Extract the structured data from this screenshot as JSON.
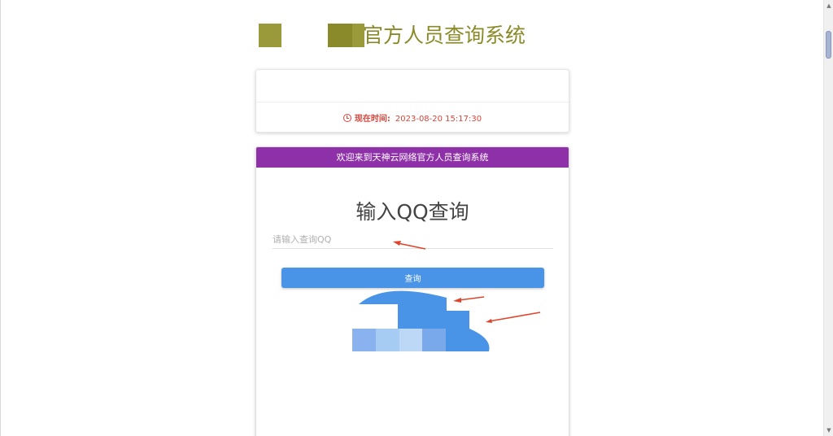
{
  "header": {
    "site_title": "官方人员查询系统"
  },
  "time_card": {
    "label": "现在时间:",
    "value": "2023-08-20 15:17:30"
  },
  "panel": {
    "header_text": "欢迎来到天神云网络官方人员查询系统",
    "heading": "输入QQ查询",
    "input_placeholder": "请输入查询QQ",
    "input_value": "",
    "button_label": "查询"
  },
  "colors": {
    "panel_header_bg": "#8e30a8",
    "button_bg": "#4a94e8",
    "time_text": "#d9453b",
    "title_text": "#8a8a28",
    "annotation_arrow": "#e0452c"
  },
  "icons": {
    "time": "clock-icon",
    "scroll_up": "chevron-up-icon",
    "scroll_down": "chevron-down-icon"
  }
}
